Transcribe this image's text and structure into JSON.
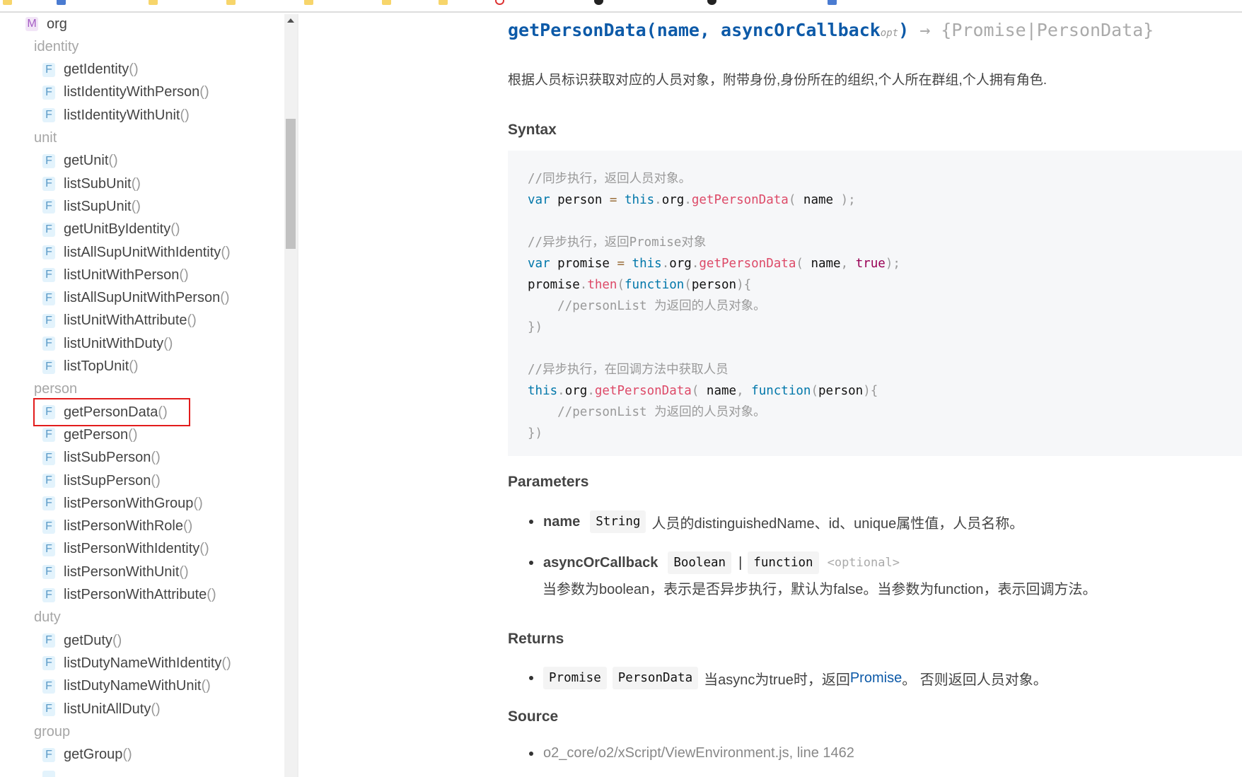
{
  "bookmarks": [
    {
      "icon": "folder-icon"
    },
    {
      "icon": "doc-icon"
    },
    {
      "icon": "folder-icon"
    },
    {
      "icon": "folder-icon"
    },
    {
      "icon": "folder-icon"
    },
    {
      "icon": "folder-icon"
    },
    {
      "icon": "folder-icon"
    },
    {
      "icon": "gitee-icon"
    },
    {
      "icon": "github-icon"
    },
    {
      "icon": "chatgpt-icon"
    },
    {
      "icon": "doc-icon"
    }
  ],
  "sidebar": {
    "module": {
      "badge": "M",
      "label": "org"
    },
    "fn_badge": "F",
    "paren": "()",
    "sections": [
      {
        "label": "identity",
        "items": [
          "getIdentity",
          "listIdentityWithPerson",
          "listIdentityWithUnit"
        ]
      },
      {
        "label": "unit",
        "items": [
          "getUnit",
          "listSubUnit",
          "listSupUnit",
          "getUnitByIdentity",
          "listAllSupUnitWithIdentity",
          "listUnitWithPerson",
          "listAllSupUnitWithPerson",
          "listUnitWithAttribute",
          "listUnitWithDuty",
          "listTopUnit"
        ]
      },
      {
        "label": "person",
        "items": [
          "getPersonData",
          "getPerson",
          "listSubPerson",
          "listSupPerson",
          "listPersonWithGroup",
          "listPersonWithRole",
          "listPersonWithIdentity",
          "listPersonWithUnit",
          "listPersonWithAttribute"
        ]
      },
      {
        "label": "duty",
        "items": [
          "getDuty",
          "listDutyNameWithIdentity",
          "listDutyNameWithUnit",
          "listUnitAllDuty"
        ]
      },
      {
        "label": "group",
        "items": [
          "getGroup"
        ]
      }
    ],
    "selected": "getPersonData"
  },
  "doc": {
    "title_name": "getPersonData(name, asyncOrCallback",
    "title_opt": "opt",
    "title_close": ")",
    "title_returns": " → {Promise|PersonData}",
    "description": "根据人员标识获取对应的人员对象，附带身份,身份所在的组织,个人所在群组,个人拥有角色.",
    "syntax_heading": "Syntax",
    "parameters_heading": "Parameters",
    "returns_heading": "Returns",
    "source_heading": "Source",
    "params": [
      {
        "name": "name",
        "types": [
          "String"
        ],
        "desc": "人员的distinguishedName、id、unique属性值，人员名称。"
      },
      {
        "name": "asyncOrCallback",
        "types": [
          "Boolean",
          "function"
        ],
        "optional": "<optional>",
        "desc": "当参数为boolean，表示是否异步执行，默认为false。当参数为function，表示回调方法。"
      }
    ],
    "returns": {
      "types": [
        "Promise",
        "PersonData"
      ],
      "desc_before": "当async为true时，返回 ",
      "link": "Promise",
      "desc_after": "。 否则返回人员对象。"
    },
    "source": "o2_core/o2/xScript/ViewEnvironment.js, line 1462"
  },
  "code": {
    "c1": "//同步执行，返回人员对象。",
    "c2": "//异步执行，返回Promise对象",
    "c3": "//personList 为返回的人员对象。",
    "c4": "//异步执行，在回调方法中获取人员",
    "method": "getPersonData"
  }
}
